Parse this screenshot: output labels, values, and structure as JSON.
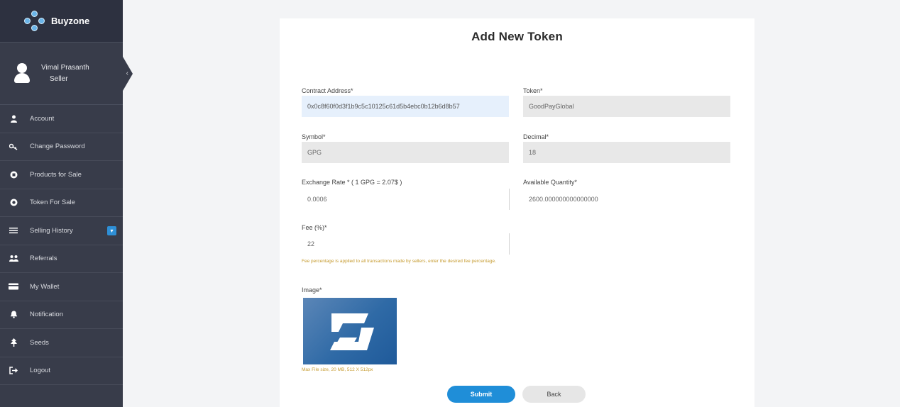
{
  "brand": {
    "name": "Buyzone"
  },
  "profile": {
    "name": "Vimal Prasanth",
    "role": "Seller"
  },
  "sidebar": {
    "items": [
      {
        "label": "Account",
        "icon": "user-icon"
      },
      {
        "label": "Change Password",
        "icon": "key-icon"
      },
      {
        "label": "Products for Sale",
        "icon": "product-icon"
      },
      {
        "label": "Token For Sale",
        "icon": "token-icon"
      },
      {
        "label": "Selling History",
        "icon": "list-icon"
      },
      {
        "label": "Referrals",
        "icon": "referrals-icon"
      },
      {
        "label": "My Wallet",
        "icon": "wallet-icon"
      },
      {
        "label": "Notification",
        "icon": "bell-icon"
      },
      {
        "label": "Seeds",
        "icon": "seeds-icon"
      },
      {
        "label": "Logout",
        "icon": "logout-icon"
      }
    ]
  },
  "form": {
    "title": "Add New Token",
    "contract_address_label": "Contract Address*",
    "contract_address_value": "0x0c8f60f0d3f1b9c5c10125c61d5b4ebc0b12b6d8b57",
    "token_label": "Token*",
    "token_value": "GoodPayGlobal",
    "symbol_label": "Symbol*",
    "symbol_value": "GPG",
    "decimal_label": "Decimal*",
    "decimal_value": "18",
    "exchange_rate_label": "Exchange Rate * ( 1 GPG = 2.07$ )",
    "exchange_rate_value": "0.0006",
    "available_qty_label": "Available Quantity*",
    "available_qty_value": "2600.000000000000000",
    "fee_label": "Fee (%)*",
    "fee_value": "22",
    "fee_hint": "Fee percentage is applied to all transactions made by sellers, enter the desired fee percentage.",
    "image_label": "Image*",
    "image_caption": "Max File size, 20 MB, 512 X 512px",
    "submit_label": "Submit",
    "back_label": "Back"
  },
  "colors": {
    "sidebar_bg": "#383c4a",
    "accent": "#1f8ed8",
    "hint": "#c59a2e"
  }
}
